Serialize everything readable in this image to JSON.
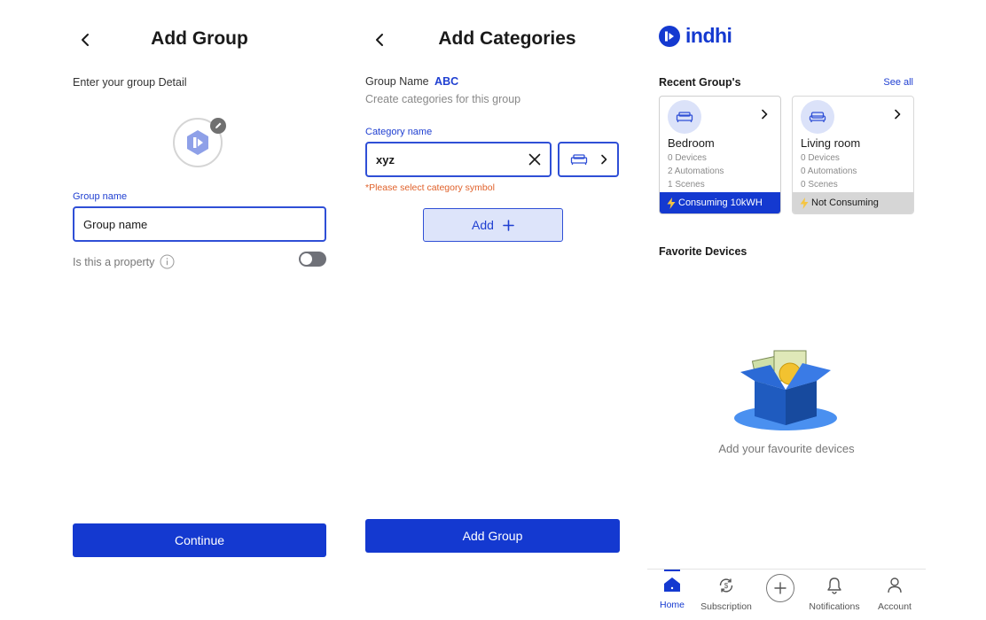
{
  "add_group": {
    "title": "Add Group",
    "subtitle": "Enter your group Detail",
    "group_name_label": "Group name",
    "group_name_value": "Group name",
    "property_label": "Is this a property",
    "continue_label": "Continue"
  },
  "add_categories": {
    "title": "Add Categories",
    "group_name_prefix": "Group Name",
    "group_name_value": "ABC",
    "subtitle": "Create categories for this group",
    "category_label": "Category name",
    "category_value": "xyz",
    "error_text": "*Please select category symbol",
    "add_label": "Add",
    "add_group_label": "Add Group"
  },
  "home": {
    "brand": "indhi",
    "recent_title": "Recent Group's",
    "see_all": "See all",
    "cards": [
      {
        "name": "Bedroom",
        "devices": "0 Devices",
        "automations": "2 Automations",
        "scenes": "1 Scenes",
        "status": "Consuming 10kWH"
      },
      {
        "name": "Living room",
        "devices": "0 Devices",
        "automations": "0 Automations",
        "scenes": "0 Scenes",
        "status": "Not Consuming"
      }
    ],
    "favorite_title": "Favorite Devices",
    "empty_text": "Add your favourite devices",
    "tabs": [
      "Home",
      "Subscription",
      "Notifications",
      "Account"
    ]
  },
  "colors": {
    "primary": "#1439d0",
    "accent_text": "#1f3fd1",
    "error": "#e0612a",
    "consuming_bg": "#1439d0",
    "not_consuming_bg": "#d6d6d6"
  },
  "icons": [
    "back-arrow-icon",
    "edit-pencil-icon",
    "logo-icon",
    "info-icon",
    "clear-x-icon",
    "bed-icon",
    "sofa-icon",
    "chevron-right-icon",
    "plus-icon",
    "lightning-icon",
    "home-icon",
    "subscription-icon",
    "add-circle-icon",
    "bell-icon",
    "account-icon",
    "empty-box-illustration"
  ]
}
